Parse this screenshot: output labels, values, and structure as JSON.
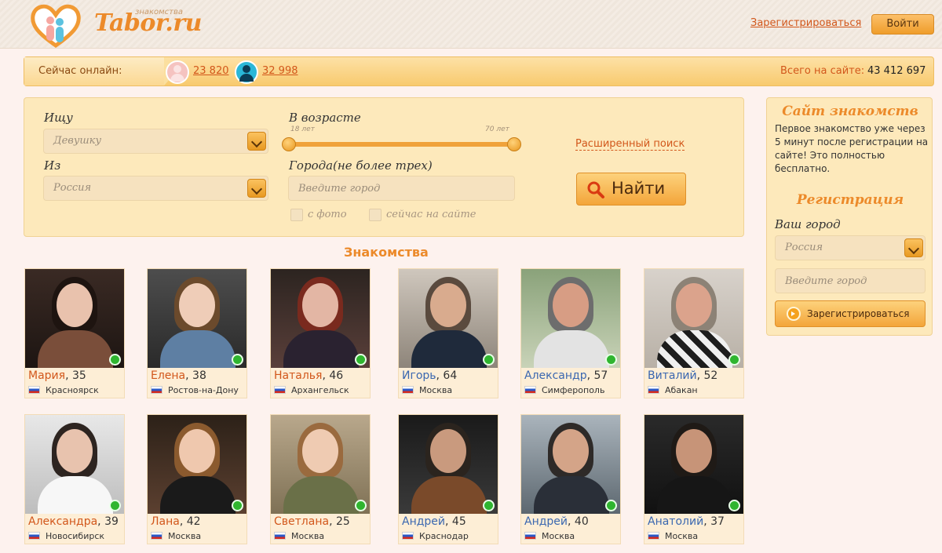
{
  "header": {
    "logo_text": "Tabor.ru",
    "logo_sub": "знакомства",
    "register_link": "Зарегистрироваться",
    "login_button": "Войти"
  },
  "online": {
    "label": "Сейчас онлайн:",
    "female_count": "23 820",
    "male_count": "32 998",
    "total_label": "Всего на сайте:",
    "total_value": "43 412 697"
  },
  "search": {
    "seek_label": "Ищу",
    "seek_value": "Девушку",
    "from_label": "Из",
    "from_value": "Россия",
    "age_label": "В возрасте",
    "age_min": "18 лет",
    "age_max": "70 лет",
    "cities_label": "Города(не более трех)",
    "city_placeholder": "Введите город",
    "with_photo": "с фото",
    "online_now": "сейчас на сайте",
    "advanced_link": "Расширенный поиск",
    "find_button": "Найти"
  },
  "section_title": "Знакомства",
  "profiles": [
    {
      "name": "Мария",
      "age": ", 35",
      "city": "Красноярск",
      "gender": "f"
    },
    {
      "name": "Елена",
      "age": ", 38",
      "city": "Ростов-на-Дону",
      "gender": "f"
    },
    {
      "name": "Наталья",
      "age": ", 46",
      "city": "Архангельск",
      "gender": "f"
    },
    {
      "name": "Игорь",
      "age": ", 64",
      "city": "Москва",
      "gender": "m"
    },
    {
      "name": "Александр",
      "age": ", 57",
      "city": "Симферополь",
      "gender": "m"
    },
    {
      "name": "Виталий",
      "age": ", 52",
      "city": "Абакан",
      "gender": "m"
    },
    {
      "name": "Александра",
      "age": ", 39",
      "city": "Новосибирск",
      "gender": "f"
    },
    {
      "name": "Лана",
      "age": ", 42",
      "city": "Москва",
      "gender": "f"
    },
    {
      "name": "Светлана",
      "age": ", 25",
      "city": "Москва",
      "gender": "f"
    },
    {
      "name": "Андрей",
      "age": ", 45",
      "city": "Краснодар",
      "gender": "m"
    },
    {
      "name": "Андрей",
      "age": ", 40",
      "city": "Москва",
      "gender": "m"
    },
    {
      "name": "Анатолий",
      "age": ", 37",
      "city": "Москва",
      "gender": "m"
    }
  ],
  "sidebar": {
    "title": "Сайт знакомств",
    "text": "Первое знакомство уже через 5 минут после регистрации на сайте! Это полностью бесплатно.",
    "reg_title": "Регистрация",
    "city_label": "Ваш город",
    "country_value": "Россия",
    "city_placeholder": "Введите город",
    "register_button": "Зарегистрироваться"
  },
  "colors": {
    "accent": "#ec8a2a",
    "link": "#d2571b",
    "male_name": "#3a67b0",
    "online_dot": "#2fb52f"
  }
}
